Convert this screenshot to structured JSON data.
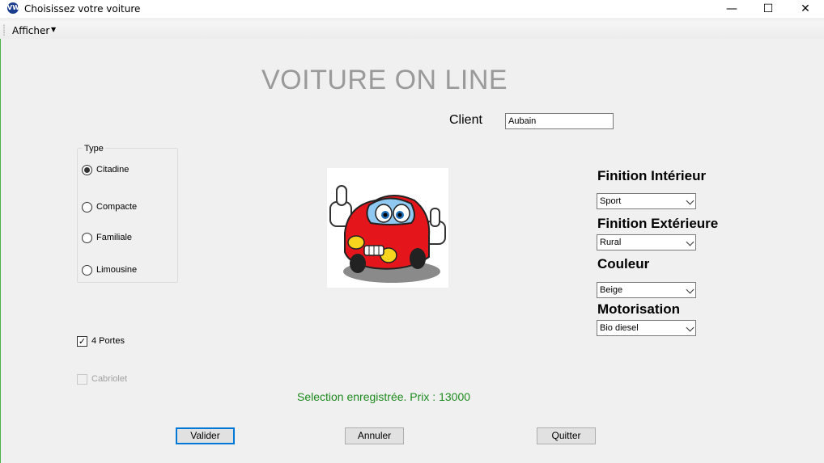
{
  "window": {
    "title": "Choisissez votre voiture",
    "icon": "volkswagen-logo-icon",
    "controls": {
      "minimize": "—",
      "maximize": "☐",
      "close": "✕"
    }
  },
  "menu": {
    "afficher": "Afficher",
    "arrow": "▼"
  },
  "header": {
    "title": "VOITURE ON LINE"
  },
  "client": {
    "label": "Client",
    "value": "Aubain"
  },
  "type_group": {
    "legend": "Type",
    "options": [
      {
        "label": "Citadine",
        "checked": true
      },
      {
        "label": "Compacte",
        "checked": false
      },
      {
        "label": "Familiale",
        "checked": false
      },
      {
        "label": "Limousine",
        "checked": false
      }
    ]
  },
  "options": {
    "portes": {
      "label": "4 Portes",
      "checked": true,
      "mark": "✓"
    },
    "cabriolet": {
      "label": "Cabriolet",
      "checked": false,
      "enabled": false
    }
  },
  "image": {
    "icon": "cartoon-red-car-icon"
  },
  "finitions": {
    "interieur": {
      "label": "Finition Intérieur",
      "value": "Sport"
    },
    "exterieur": {
      "label": "Finition Extérieure",
      "value": "Rural"
    },
    "couleur": {
      "label": "Couleur",
      "value": "Beige"
    },
    "motorisation": {
      "label": "Motorisation",
      "value": "Bio diesel"
    }
  },
  "status": {
    "text": "Selection enregistrée. Prix : 13000",
    "color": "#1e8a1e"
  },
  "buttons": {
    "valider": "Valider",
    "annuler": "Annuler",
    "quitter": "Quitter"
  }
}
